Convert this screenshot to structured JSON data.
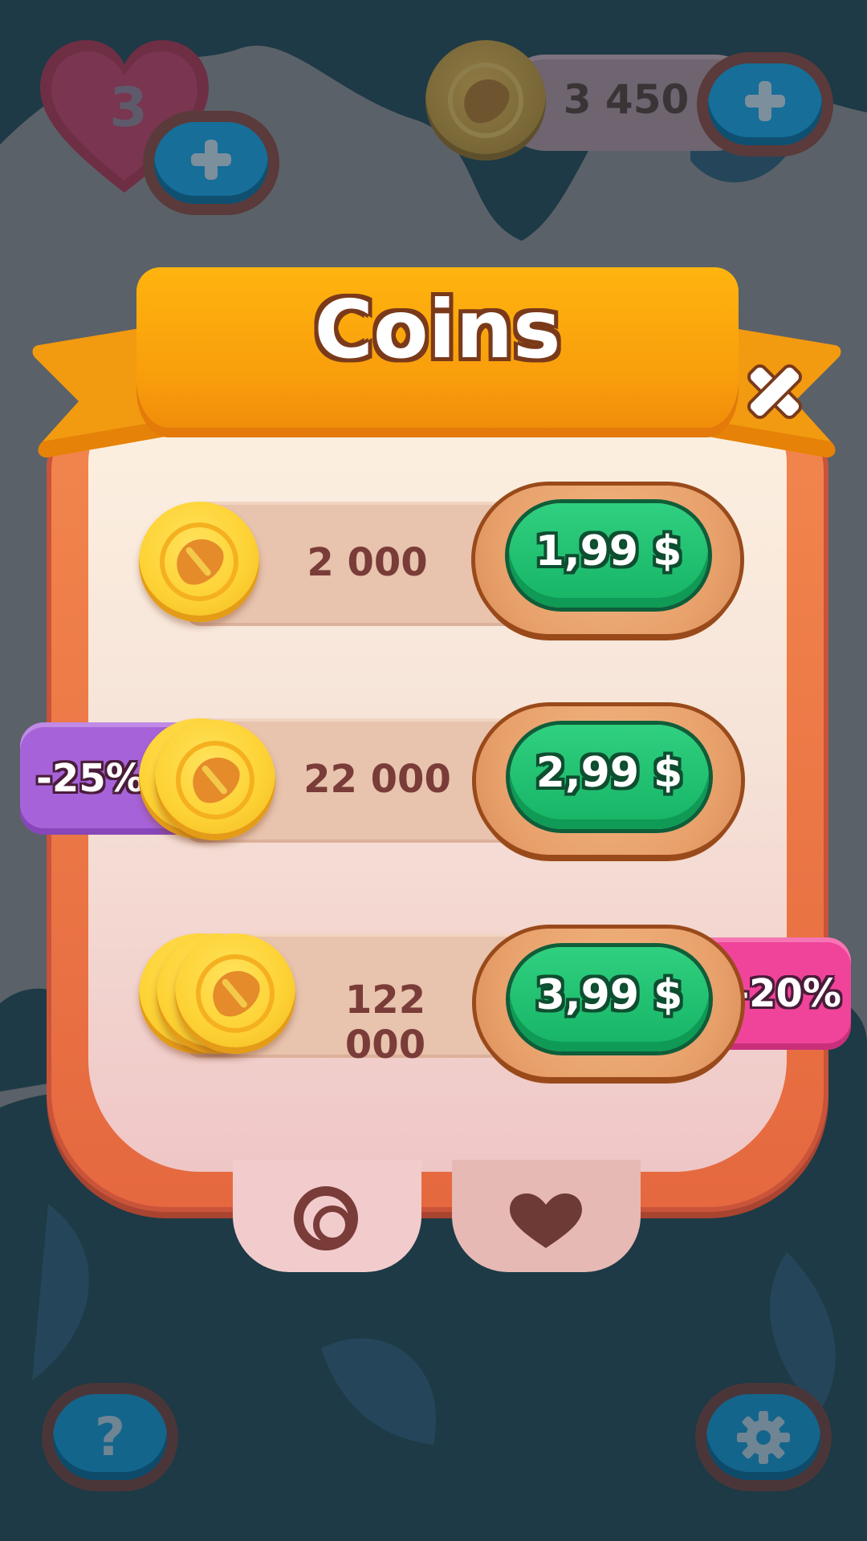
{
  "hud": {
    "lives": "3",
    "coins": "3 450"
  },
  "popup": {
    "title": "Coins",
    "offers": [
      {
        "amount": "2 000",
        "price": "1,99 $",
        "discount": ""
      },
      {
        "amount": "22 000",
        "price": "2,99 $",
        "discount": "-25%"
      },
      {
        "amount": "122 000",
        "price": "3,99 $",
        "discount": "-20%"
      }
    ],
    "tabs": [
      "target-icon",
      "heart-icon"
    ]
  },
  "footer": {
    "help_label": "?",
    "settings_icon": "gear-icon"
  },
  "colors": {
    "ribbon": "#f89d0c",
    "buy_green": "#16b365",
    "badge_purple": "#a663d9",
    "badge_pink": "#f0449a"
  }
}
